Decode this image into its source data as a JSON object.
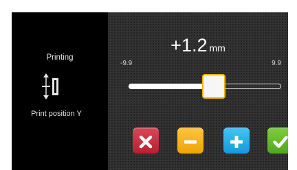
{
  "left_panel": {
    "mode_label": "Printing",
    "function_label": "Print position Y",
    "icon": "print-position-y-icon"
  },
  "adjustment": {
    "value": "+1.2",
    "unit": "mm",
    "min_label": "-9.9",
    "max_label": "9.9",
    "slider": {
      "min": -9.9,
      "max": 9.9,
      "value": 1.2
    }
  },
  "buttons": {
    "cancel": {
      "icon": "close-icon",
      "color": "#c62b3b"
    },
    "decrease": {
      "icon": "minus-icon",
      "color": "#f6b622"
    },
    "increase": {
      "icon": "plus-icon",
      "color": "#27ace6"
    },
    "confirm": {
      "icon": "checkmark-icon",
      "color": "#62b82a"
    }
  },
  "colors": {
    "background": "#000000",
    "panel": "#333333",
    "slider_thumb_border": "#f0b400"
  }
}
